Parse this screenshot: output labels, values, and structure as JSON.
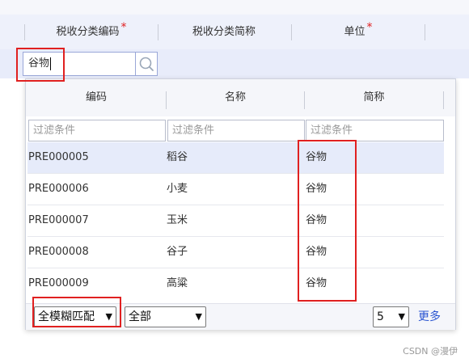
{
  "grid": {
    "columns": [
      {
        "label": "税收分类编码",
        "required": "*"
      },
      {
        "label": "税收分类简称",
        "required": ""
      },
      {
        "label": "单位",
        "required": "*"
      }
    ]
  },
  "editor": {
    "value": "谷物"
  },
  "lookup": {
    "headers": [
      "编码",
      "名称",
      "简称"
    ],
    "filter_placeholder": "过滤条件",
    "rows": [
      {
        "code": "PRE000005",
        "name": "稻谷",
        "short": "谷物",
        "selected": true
      },
      {
        "code": "PRE000006",
        "name": "小麦",
        "short": "谷物"
      },
      {
        "code": "PRE000007",
        "name": "玉米",
        "short": "谷物"
      },
      {
        "code": "PRE000008",
        "name": "谷子",
        "short": "谷物"
      },
      {
        "code": "PRE000009",
        "name": "高粱",
        "short": "谷物"
      }
    ],
    "footer": {
      "match_mode": "全模糊匹配",
      "scope": "全部",
      "page_size": "5",
      "more": "更多"
    }
  },
  "watermark": "CSDN @漫伊",
  "colors": {
    "annotation": "#e02020",
    "link": "#2b55d1",
    "selected_row": "#e6ebfa"
  }
}
